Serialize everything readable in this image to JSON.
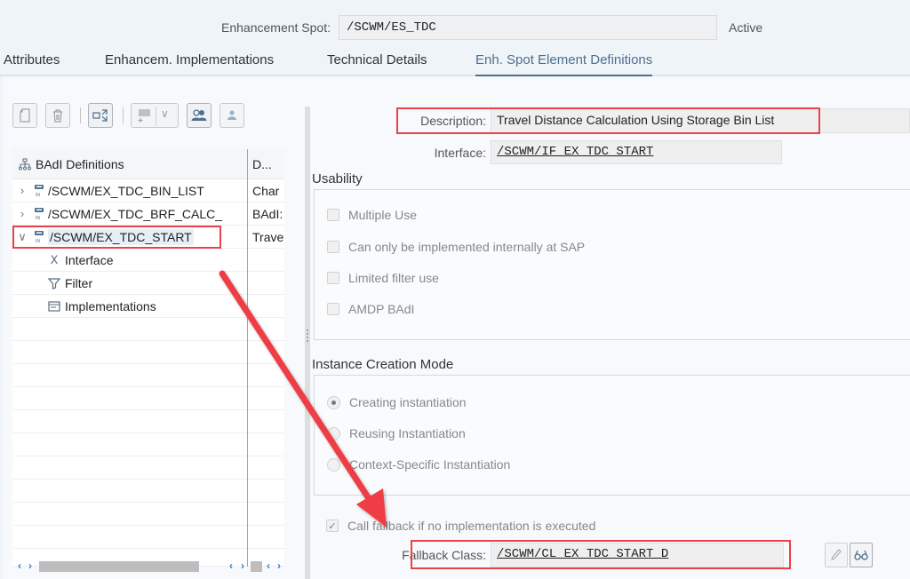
{
  "header": {
    "spot_label": "Enhancement Spot:",
    "spot_value": "/SCWM/ES_TDC",
    "status": "Active"
  },
  "tabs": [
    {
      "label": "Attributes",
      "active": false
    },
    {
      "label": "Enhancem. Implementations",
      "active": false
    },
    {
      "label": "Technical Details",
      "active": false
    },
    {
      "label": "Enh. Spot Element Definitions",
      "active": true
    }
  ],
  "toolbar": {
    "buttons": [
      {
        "name": "create-icon",
        "enabled": false
      },
      {
        "name": "delete-icon",
        "enabled": false
      },
      {
        "name": "expand-collapse-icon",
        "enabled": true
      },
      {
        "name": "add-element-icon",
        "enabled": false
      },
      {
        "name": "dropdown-icon",
        "enabled": false
      },
      {
        "name": "user-group-icon",
        "enabled": true
      },
      {
        "name": "user-icon",
        "enabled": false
      }
    ]
  },
  "tree": {
    "col1_header": "BAdI Definitions",
    "col2_header": "D...",
    "rows": [
      {
        "name": "/SCWM/EX_TDC_BIN_LIST",
        "desc": "Char",
        "expanded": false
      },
      {
        "name": "/SCWM/EX_TDC_BRF_CALC_",
        "desc": "BAdI:",
        "expanded": false
      },
      {
        "name": "/SCWM/EX_TDC_START",
        "desc": "Trave",
        "expanded": true,
        "selected": true
      }
    ],
    "children": [
      {
        "label": "Interface",
        "icon": "interface-icon"
      },
      {
        "label": "Filter",
        "icon": "filter-icon"
      },
      {
        "label": "Implementations",
        "icon": "implementations-icon"
      }
    ]
  },
  "details": {
    "description_label": "Description:",
    "description_value": "Travel Distance Calculation Using Storage Bin List",
    "interface_label": "Interface:",
    "interface_value": "/SCWM/IF_EX_TDC_START",
    "usability": {
      "title": "Usability",
      "options": [
        {
          "label": "Multiple Use",
          "checked": false
        },
        {
          "label": "Can only be implemented internally at SAP",
          "checked": false
        },
        {
          "label": "Limited filter use",
          "checked": false
        },
        {
          "label": "AMDP BAdI",
          "checked": false
        }
      ]
    },
    "instance_mode": {
      "title": "Instance Creation Mode",
      "options": [
        {
          "label": "Creating instantiation",
          "selected": true
        },
        {
          "label": "Reusing Instantiation",
          "selected": false
        },
        {
          "label": "Context-Specific Instantiation",
          "selected": false
        }
      ]
    },
    "fallback_checkbox_label": "Call fallback if no implementation is executed",
    "fallback_checked": true,
    "fallback_label": "Fallback Class:",
    "fallback_value": "/SCWM/CL_EX_TDC_START_D"
  },
  "annotations": {
    "highlight_color": "#e8434a",
    "arrow_color": "#ef3e45"
  }
}
